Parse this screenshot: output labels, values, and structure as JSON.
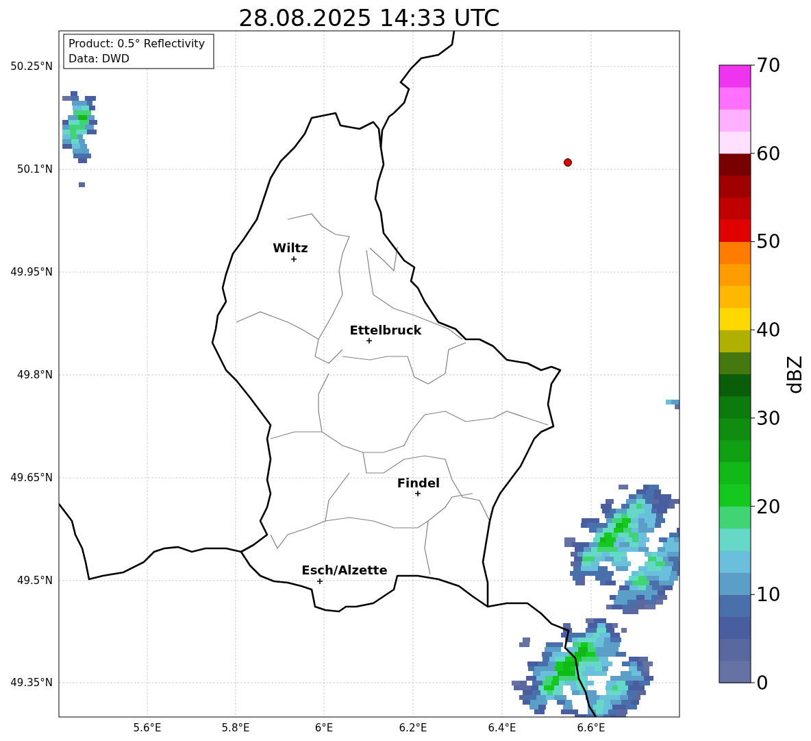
{
  "title": "28.08.2025 14:33 UTC",
  "info_box": [
    "Product: 0.5° Reflectivity",
    "Data: DWD"
  ],
  "map": {
    "x_tick_labels": [
      "5.6°E",
      "5.8°E",
      "6°E",
      "6.2°E",
      "6.4°E",
      "6.6°E"
    ],
    "y_tick_labels": [
      "50.25°N",
      "50.1°N",
      "49.95°N",
      "49.8°N",
      "49.65°N",
      "49.5°N",
      "49.35°N"
    ],
    "places": [
      {
        "name": "Wiltz"
      },
      {
        "name": "Ettelbruck"
      },
      {
        "name": "Findel"
      },
      {
        "name": "Esch/Alzette"
      }
    ]
  },
  "colorbar": {
    "label": "dBZ",
    "tick_labels": [
      "70",
      "60",
      "50",
      "40",
      "30",
      "20",
      "10",
      "0"
    ],
    "segments": [
      {
        "color": "#6672a4"
      },
      {
        "color": "#5a68a0"
      },
      {
        "color": "#485ea0"
      },
      {
        "color": "#4a70ac"
      },
      {
        "color": "#5b9ec8"
      },
      {
        "color": "#6ac0dc"
      },
      {
        "color": "#66d8c8"
      },
      {
        "color": "#40d474"
      },
      {
        "color": "#14c81e"
      },
      {
        "color": "#10b818"
      },
      {
        "color": "#10a014"
      },
      {
        "color": "#108c10"
      },
      {
        "color": "#0c7a0c"
      },
      {
        "color": "#0a5e0a"
      },
      {
        "color": "#467810"
      },
      {
        "color": "#b0b000"
      },
      {
        "color": "#ffd800"
      },
      {
        "color": "#ffb800"
      },
      {
        "color": "#ff9c00"
      },
      {
        "color": "#ff7c00"
      },
      {
        "color": "#e00000"
      },
      {
        "color": "#c00000"
      },
      {
        "color": "#a00000"
      },
      {
        "color": "#780000"
      },
      {
        "color": "#ffe0ff"
      },
      {
        "color": "#ffb0ff"
      },
      {
        "color": "#ff70ff"
      },
      {
        "color": "#ee34ee"
      }
    ]
  }
}
